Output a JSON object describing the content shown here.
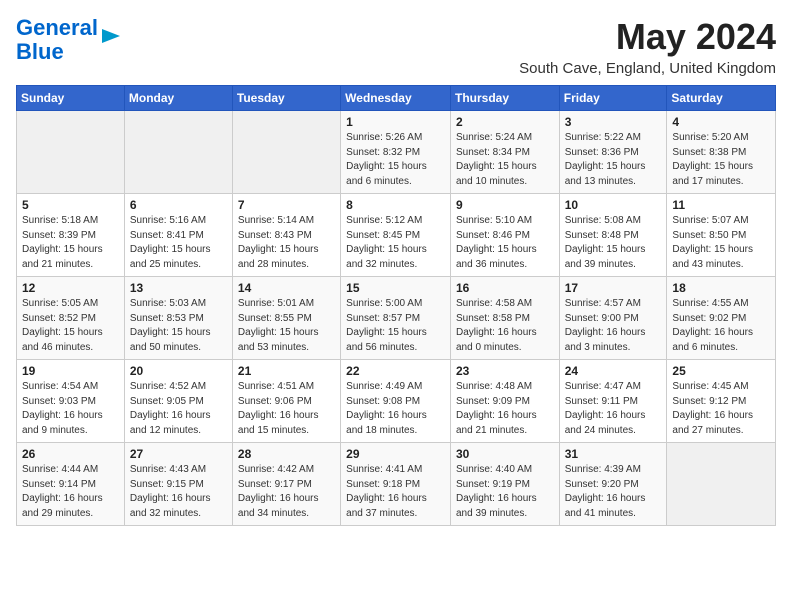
{
  "header": {
    "logo_line1": "General",
    "logo_line2": "Blue",
    "month": "May 2024",
    "location": "South Cave, England, United Kingdom"
  },
  "weekdays": [
    "Sunday",
    "Monday",
    "Tuesday",
    "Wednesday",
    "Thursday",
    "Friday",
    "Saturday"
  ],
  "weeks": [
    [
      {
        "day": "",
        "info": ""
      },
      {
        "day": "",
        "info": ""
      },
      {
        "day": "",
        "info": ""
      },
      {
        "day": "1",
        "info": "Sunrise: 5:26 AM\nSunset: 8:32 PM\nDaylight: 15 hours\nand 6 minutes."
      },
      {
        "day": "2",
        "info": "Sunrise: 5:24 AM\nSunset: 8:34 PM\nDaylight: 15 hours\nand 10 minutes."
      },
      {
        "day": "3",
        "info": "Sunrise: 5:22 AM\nSunset: 8:36 PM\nDaylight: 15 hours\nand 13 minutes."
      },
      {
        "day": "4",
        "info": "Sunrise: 5:20 AM\nSunset: 8:38 PM\nDaylight: 15 hours\nand 17 minutes."
      }
    ],
    [
      {
        "day": "5",
        "info": "Sunrise: 5:18 AM\nSunset: 8:39 PM\nDaylight: 15 hours\nand 21 minutes."
      },
      {
        "day": "6",
        "info": "Sunrise: 5:16 AM\nSunset: 8:41 PM\nDaylight: 15 hours\nand 25 minutes."
      },
      {
        "day": "7",
        "info": "Sunrise: 5:14 AM\nSunset: 8:43 PM\nDaylight: 15 hours\nand 28 minutes."
      },
      {
        "day": "8",
        "info": "Sunrise: 5:12 AM\nSunset: 8:45 PM\nDaylight: 15 hours\nand 32 minutes."
      },
      {
        "day": "9",
        "info": "Sunrise: 5:10 AM\nSunset: 8:46 PM\nDaylight: 15 hours\nand 36 minutes."
      },
      {
        "day": "10",
        "info": "Sunrise: 5:08 AM\nSunset: 8:48 PM\nDaylight: 15 hours\nand 39 minutes."
      },
      {
        "day": "11",
        "info": "Sunrise: 5:07 AM\nSunset: 8:50 PM\nDaylight: 15 hours\nand 43 minutes."
      }
    ],
    [
      {
        "day": "12",
        "info": "Sunrise: 5:05 AM\nSunset: 8:52 PM\nDaylight: 15 hours\nand 46 minutes."
      },
      {
        "day": "13",
        "info": "Sunrise: 5:03 AM\nSunset: 8:53 PM\nDaylight: 15 hours\nand 50 minutes."
      },
      {
        "day": "14",
        "info": "Sunrise: 5:01 AM\nSunset: 8:55 PM\nDaylight: 15 hours\nand 53 minutes."
      },
      {
        "day": "15",
        "info": "Sunrise: 5:00 AM\nSunset: 8:57 PM\nDaylight: 15 hours\nand 56 minutes."
      },
      {
        "day": "16",
        "info": "Sunrise: 4:58 AM\nSunset: 8:58 PM\nDaylight: 16 hours\nand 0 minutes."
      },
      {
        "day": "17",
        "info": "Sunrise: 4:57 AM\nSunset: 9:00 PM\nDaylight: 16 hours\nand 3 minutes."
      },
      {
        "day": "18",
        "info": "Sunrise: 4:55 AM\nSunset: 9:02 PM\nDaylight: 16 hours\nand 6 minutes."
      }
    ],
    [
      {
        "day": "19",
        "info": "Sunrise: 4:54 AM\nSunset: 9:03 PM\nDaylight: 16 hours\nand 9 minutes."
      },
      {
        "day": "20",
        "info": "Sunrise: 4:52 AM\nSunset: 9:05 PM\nDaylight: 16 hours\nand 12 minutes."
      },
      {
        "day": "21",
        "info": "Sunrise: 4:51 AM\nSunset: 9:06 PM\nDaylight: 16 hours\nand 15 minutes."
      },
      {
        "day": "22",
        "info": "Sunrise: 4:49 AM\nSunset: 9:08 PM\nDaylight: 16 hours\nand 18 minutes."
      },
      {
        "day": "23",
        "info": "Sunrise: 4:48 AM\nSunset: 9:09 PM\nDaylight: 16 hours\nand 21 minutes."
      },
      {
        "day": "24",
        "info": "Sunrise: 4:47 AM\nSunset: 9:11 PM\nDaylight: 16 hours\nand 24 minutes."
      },
      {
        "day": "25",
        "info": "Sunrise: 4:45 AM\nSunset: 9:12 PM\nDaylight: 16 hours\nand 27 minutes."
      }
    ],
    [
      {
        "day": "26",
        "info": "Sunrise: 4:44 AM\nSunset: 9:14 PM\nDaylight: 16 hours\nand 29 minutes."
      },
      {
        "day": "27",
        "info": "Sunrise: 4:43 AM\nSunset: 9:15 PM\nDaylight: 16 hours\nand 32 minutes."
      },
      {
        "day": "28",
        "info": "Sunrise: 4:42 AM\nSunset: 9:17 PM\nDaylight: 16 hours\nand 34 minutes."
      },
      {
        "day": "29",
        "info": "Sunrise: 4:41 AM\nSunset: 9:18 PM\nDaylight: 16 hours\nand 37 minutes."
      },
      {
        "day": "30",
        "info": "Sunrise: 4:40 AM\nSunset: 9:19 PM\nDaylight: 16 hours\nand 39 minutes."
      },
      {
        "day": "31",
        "info": "Sunrise: 4:39 AM\nSunset: 9:20 PM\nDaylight: 16 hours\nand 41 minutes."
      },
      {
        "day": "",
        "info": ""
      }
    ]
  ]
}
